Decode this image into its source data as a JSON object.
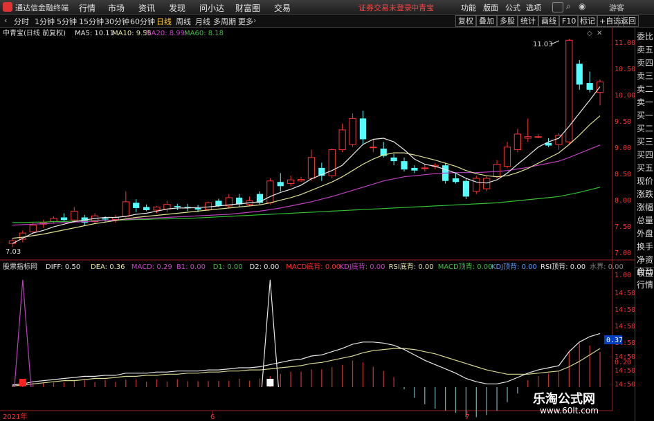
{
  "app": {
    "title": "通达信金融终端"
  },
  "menu": [
    "行情",
    "市场",
    "资讯",
    "发现",
    "问小达",
    "财富圈",
    "交易"
  ],
  "notice": "证券交易未登录",
  "stock_name": "中青宝",
  "right_menu": [
    "功能",
    "版面",
    "公式",
    "选项"
  ],
  "guest": "游客",
  "periods": [
    "分时",
    "1分钟",
    "5分钟",
    "15分钟",
    "30分钟",
    "60分钟",
    "日线",
    "周线",
    "月线",
    "多周期",
    "更多"
  ],
  "active_period": "日线",
  "right_tools": [
    "复权",
    "叠加",
    "多股",
    "统计",
    "画线",
    "F10",
    "标记",
    "+自选",
    "返回"
  ],
  "sidebar": [
    "委比",
    "卖五",
    "卖四",
    "卖三",
    "卖二",
    "卖一",
    "买一",
    "买二",
    "买三",
    "买四",
    "买五",
    "现价",
    "涨跌",
    "涨幅",
    "总量",
    "外盘",
    "换手",
    "净资",
    "收益"
  ],
  "sidebar_lower": [
    "自动",
    "行情"
  ],
  "main_info": {
    "label": "中青宝(日线 前复权)",
    "ma5": "MA5: 10.11",
    "ma10": "MA10: 9.55",
    "ma20": "MA20: 8.99",
    "ma60": "MA60: 8.18"
  },
  "sub_info": {
    "label": "股票指标网",
    "items": [
      {
        "t": "DIFF: 0.50",
        "c": "#e8e8e8"
      },
      {
        "t": "DEA: 0.36",
        "c": "#e8e8a0"
      },
      {
        "t": "MACD: 0.29",
        "c": "#d040d0"
      },
      {
        "t": "B1: 0.00",
        "c": "#d040d0"
      },
      {
        "t": "D1: 0.00",
        "c": "#40c040"
      },
      {
        "t": "D2: 0.00",
        "c": "#e8e8e8"
      },
      {
        "t": "MACD底背: 0.00",
        "c": "#ff3030"
      },
      {
        "t": "KDJ底背: 0.00",
        "c": "#d040d0"
      },
      {
        "t": "RSI底背: 0.00",
        "c": "#e8e8a0"
      },
      {
        "t": "MACD顶背: 0.00",
        "c": "#40c040"
      },
      {
        "t": "KDJ顶背: 0.00",
        "c": "#60a0ff"
      },
      {
        "t": "RSI顶背: 0.00",
        "c": "#e8e8e8"
      },
      {
        "t": "水界: 0.00",
        "c": "#888888"
      }
    ]
  },
  "price_axis": [
    "11.00",
    "10.50",
    "10.00",
    "9.50",
    "9.00",
    "8.50",
    "8.00",
    "7.50",
    "7.00"
  ],
  "sub_axis": [
    "1.00",
    "14:50",
    "14:50",
    "14:50",
    "14:50",
    "14:50",
    "0.37",
    "14:50",
    "0.20",
    "14:50"
  ],
  "max_label": "11.03",
  "min_label": "7.03",
  "date_labels": [
    "2021年",
    "6",
    "7"
  ],
  "current_value": "0.37",
  "watermark": {
    "cn": "乐淘公式网",
    "url": "www.60lt.com"
  },
  "chart_data": {
    "type": "candlestick",
    "ohlc": [
      [
        7.1,
        7.2,
        7.03,
        7.15
      ],
      [
        7.18,
        7.35,
        7.12,
        7.3
      ],
      [
        7.32,
        7.5,
        7.28,
        7.45
      ],
      [
        7.47,
        7.55,
        7.4,
        7.5
      ],
      [
        7.52,
        7.62,
        7.48,
        7.58
      ],
      [
        7.6,
        7.68,
        7.52,
        7.55
      ],
      [
        7.55,
        7.8,
        7.5,
        7.72
      ],
      [
        7.6,
        7.65,
        7.45,
        7.5
      ],
      [
        7.52,
        7.68,
        7.48,
        7.63
      ],
      [
        7.58,
        7.62,
        7.52,
        7.56
      ],
      [
        7.56,
        7.65,
        7.5,
        7.6
      ],
      [
        7.62,
        8.1,
        7.6,
        7.9
      ],
      [
        7.88,
        7.95,
        7.7,
        7.78
      ],
      [
        7.8,
        7.85,
        7.72,
        7.74
      ],
      [
        7.74,
        7.82,
        7.68,
        7.8
      ],
      [
        7.76,
        7.92,
        7.7,
        7.85
      ],
      [
        7.82,
        7.86,
        7.74,
        7.8
      ],
      [
        7.8,
        7.86,
        7.72,
        7.78
      ],
      [
        7.78,
        7.84,
        7.7,
        7.75
      ],
      [
        7.75,
        7.9,
        7.72,
        7.88
      ],
      [
        7.92,
        7.96,
        7.8,
        7.82
      ],
      [
        7.82,
        8.05,
        7.78,
        7.98
      ],
      [
        7.98,
        8.05,
        7.8,
        7.85
      ],
      [
        7.85,
        8.0,
        7.82,
        7.92
      ],
      [
        8.05,
        8.1,
        7.85,
        7.88
      ],
      [
        7.88,
        8.35,
        7.85,
        8.3
      ],
      [
        8.28,
        8.45,
        8.1,
        8.2
      ],
      [
        8.25,
        8.4,
        8.2,
        8.32
      ],
      [
        8.3,
        8.38,
        8.28,
        8.33
      ],
      [
        8.35,
        8.9,
        8.3,
        8.75
      ],
      [
        8.55,
        8.65,
        8.3,
        8.4
      ],
      [
        8.4,
        8.92,
        8.35,
        8.9
      ],
      [
        8.9,
        9.4,
        8.85,
        9.28
      ],
      [
        9.0,
        9.6,
        8.95,
        9.5
      ],
      [
        9.5,
        9.65,
        9.0,
        9.1
      ],
      [
        8.95,
        9.1,
        8.85,
        8.95
      ],
      [
        8.92,
        9.05,
        8.75,
        8.78
      ],
      [
        8.75,
        8.82,
        8.6,
        8.68
      ],
      [
        8.68,
        8.75,
        8.48,
        8.52
      ],
      [
        8.55,
        8.6,
        8.45,
        8.5
      ],
      [
        8.55,
        8.62,
        8.48,
        8.55
      ],
      [
        8.58,
        8.64,
        8.52,
        8.6
      ],
      [
        8.6,
        8.65,
        8.25,
        8.3
      ],
      [
        8.35,
        8.45,
        8.25,
        8.28
      ],
      [
        8.3,
        8.35,
        7.95,
        8.0
      ],
      [
        8.1,
        8.4,
        8.05,
        8.35
      ],
      [
        8.15,
        8.4,
        8.1,
        8.35
      ],
      [
        8.38,
        8.7,
        8.35,
        8.62
      ],
      [
        8.58,
        9.05,
        8.55,
        8.95
      ],
      [
        8.9,
        9.3,
        8.85,
        9.2
      ],
      [
        9.12,
        9.5,
        9.05,
        9.15
      ],
      [
        9.15,
        9.2,
        9.12,
        9.15
      ],
      [
        9.03,
        9.12,
        8.95,
        8.98
      ],
      [
        9.0,
        9.22,
        8.9,
        9.18
      ],
      [
        9.05,
        11.03,
        9.0,
        11.0
      ],
      [
        10.55,
        10.62,
        10.05,
        10.15
      ],
      [
        10.18,
        10.4,
        10.0,
        10.05
      ],
      [
        10.0,
        10.25,
        9.75,
        10.2
      ]
    ],
    "ma5": [
      7.1,
      7.2,
      7.3,
      7.35,
      7.42,
      7.47,
      7.52,
      7.55,
      7.58,
      7.6,
      7.6,
      7.62,
      7.66,
      7.68,
      7.72,
      7.76,
      7.78,
      7.78,
      7.79,
      7.8,
      7.82,
      7.84,
      7.86,
      7.88,
      7.9,
      8.0,
      8.08,
      8.14,
      8.22,
      8.34,
      8.42,
      8.5,
      8.6,
      8.8,
      9.0,
      9.1,
      9.12,
      9.05,
      8.9,
      8.72,
      8.62,
      8.58,
      8.52,
      8.45,
      8.35,
      8.28,
      8.26,
      8.32,
      8.45,
      8.62,
      8.78,
      8.95,
      9.05,
      9.12,
      9.35,
      9.6,
      9.85,
      10.11
    ],
    "ma10": [
      7.2,
      7.22,
      7.25,
      7.28,
      7.32,
      7.36,
      7.4,
      7.44,
      7.48,
      7.51,
      7.54,
      7.57,
      7.6,
      7.62,
      7.64,
      7.66,
      7.68,
      7.7,
      7.72,
      7.74,
      7.76,
      7.78,
      7.8,
      7.82,
      7.84,
      7.88,
      7.93,
      7.98,
      8.04,
      8.12,
      8.2,
      8.28,
      8.38,
      8.5,
      8.62,
      8.72,
      8.8,
      8.84,
      8.84,
      8.8,
      8.75,
      8.7,
      8.64,
      8.58,
      8.5,
      8.44,
      8.4,
      8.38,
      8.4,
      8.46,
      8.54,
      8.64,
      8.74,
      8.84,
      9.0,
      9.18,
      9.38,
      9.55
    ],
    "ma20": [
      7.45,
      7.46,
      7.47,
      7.48,
      7.49,
      7.5,
      7.51,
      7.52,
      7.53,
      7.54,
      7.55,
      7.56,
      7.57,
      7.58,
      7.59,
      7.6,
      7.61,
      7.62,
      7.63,
      7.64,
      7.65,
      7.66,
      7.68,
      7.7,
      7.72,
      7.75,
      7.78,
      7.82,
      7.86,
      7.9,
      7.95,
      8.0,
      8.06,
      8.12,
      8.18,
      8.24,
      8.3,
      8.34,
      8.38,
      8.4,
      8.42,
      8.44,
      8.45,
      8.46,
      8.46,
      8.46,
      8.47,
      8.48,
      8.5,
      8.53,
      8.56,
      8.6,
      8.64,
      8.68,
      8.75,
      8.83,
      8.91,
      8.99
    ],
    "ma60": [
      7.5,
      7.5,
      7.51,
      7.51,
      7.52,
      7.52,
      7.53,
      7.53,
      7.54,
      7.54,
      7.55,
      7.55,
      7.56,
      7.56,
      7.57,
      7.57,
      7.58,
      7.58,
      7.59,
      7.6,
      7.61,
      7.62,
      7.63,
      7.64,
      7.65,
      7.66,
      7.67,
      7.68,
      7.69,
      7.7,
      7.71,
      7.72,
      7.73,
      7.74,
      7.75,
      7.76,
      7.77,
      7.78,
      7.79,
      7.8,
      7.81,
      7.82,
      7.83,
      7.84,
      7.85,
      7.86,
      7.87,
      7.88,
      7.9,
      7.92,
      7.94,
      7.96,
      7.98,
      8.0,
      8.04,
      8.08,
      8.13,
      8.18
    ],
    "diff": [
      0.02,
      0.03,
      0.05,
      0.06,
      0.07,
      0.08,
      0.09,
      0.1,
      0.1,
      0.11,
      0.11,
      0.13,
      0.13,
      0.13,
      0.14,
      0.14,
      0.15,
      0.15,
      0.15,
      0.16,
      0.16,
      0.17,
      0.18,
      0.18,
      0.19,
      0.21,
      0.23,
      0.25,
      0.26,
      0.29,
      0.3,
      0.33,
      0.36,
      0.4,
      0.42,
      0.42,
      0.41,
      0.39,
      0.35,
      0.3,
      0.25,
      0.21,
      0.17,
      0.13,
      0.08,
      0.05,
      0.03,
      0.03,
      0.05,
      0.09,
      0.13,
      0.16,
      0.18,
      0.2,
      0.33,
      0.42,
      0.47,
      0.5
    ],
    "dea": [
      0.01,
      0.02,
      0.03,
      0.04,
      0.05,
      0.06,
      0.06,
      0.07,
      0.08,
      0.08,
      0.09,
      0.1,
      0.1,
      0.11,
      0.11,
      0.12,
      0.12,
      0.13,
      0.13,
      0.14,
      0.14,
      0.15,
      0.15,
      0.16,
      0.16,
      0.17,
      0.18,
      0.19,
      0.2,
      0.22,
      0.23,
      0.25,
      0.27,
      0.29,
      0.32,
      0.34,
      0.35,
      0.36,
      0.36,
      0.35,
      0.33,
      0.31,
      0.28,
      0.25,
      0.22,
      0.19,
      0.16,
      0.14,
      0.12,
      0.12,
      0.12,
      0.13,
      0.14,
      0.15,
      0.19,
      0.24,
      0.3,
      0.36
    ],
    "signals": [
      {
        "i": 1,
        "type": "buy"
      },
      {
        "i": 25,
        "type": "sell"
      }
    ],
    "price_range": [
      6.85,
      11.15
    ],
    "sub_range": [
      -0.2,
      1.05
    ]
  }
}
